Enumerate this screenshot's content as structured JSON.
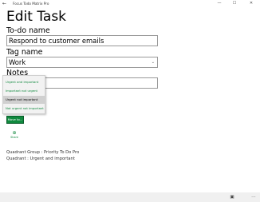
{
  "window": {
    "title": "Focus Todo Matrix Pro",
    "back_glyph": "←",
    "minimize_glyph": "—",
    "maximize_glyph": "☐",
    "close_glyph": "✕"
  },
  "page": {
    "heading": "Edit Task"
  },
  "form": {
    "todo_label": "To-do name",
    "todo_value": "Respond to customer emails",
    "tag_label": "Tag name",
    "tag_value": "Work",
    "notes_label": "Notes",
    "notes_value": ""
  },
  "dropdown": {
    "options": [
      {
        "label": "Urgent and important",
        "selected": false
      },
      {
        "label": "Important not urgent",
        "selected": false
      },
      {
        "label": "Urgent not important",
        "selected": true
      },
      {
        "label": "Not urgent not important",
        "selected": false
      }
    ]
  },
  "actions": {
    "move_label": "Move to...",
    "share_label": "Share"
  },
  "info": {
    "group_line": "Quadrant Group : Priority To Do Pro",
    "quadrant_line": "Quadrant : Urgent and important"
  },
  "colors": {
    "accent": "#10893e"
  }
}
